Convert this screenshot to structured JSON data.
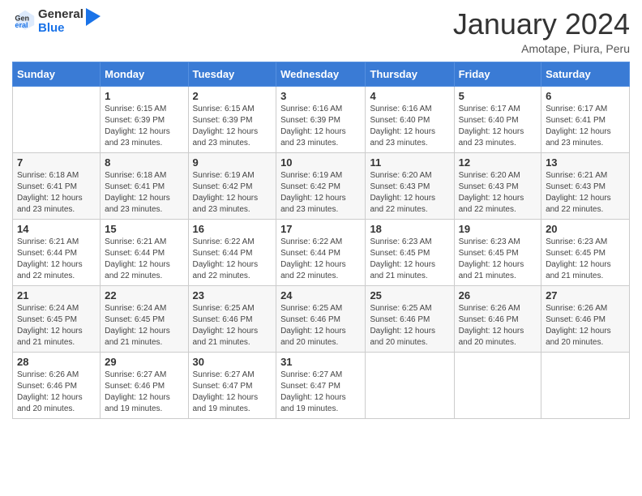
{
  "logo": {
    "general": "General",
    "blue": "Blue"
  },
  "header": {
    "month_year": "January 2024",
    "location": "Amotape, Piura, Peru"
  },
  "weekdays": [
    "Sunday",
    "Monday",
    "Tuesday",
    "Wednesday",
    "Thursday",
    "Friday",
    "Saturday"
  ],
  "weeks": [
    [
      {
        "day": "",
        "sunrise": "",
        "sunset": "",
        "daylight": ""
      },
      {
        "day": "1",
        "sunrise": "Sunrise: 6:15 AM",
        "sunset": "Sunset: 6:39 PM",
        "daylight": "Daylight: 12 hours and 23 minutes."
      },
      {
        "day": "2",
        "sunrise": "Sunrise: 6:15 AM",
        "sunset": "Sunset: 6:39 PM",
        "daylight": "Daylight: 12 hours and 23 minutes."
      },
      {
        "day": "3",
        "sunrise": "Sunrise: 6:16 AM",
        "sunset": "Sunset: 6:39 PM",
        "daylight": "Daylight: 12 hours and 23 minutes."
      },
      {
        "day": "4",
        "sunrise": "Sunrise: 6:16 AM",
        "sunset": "Sunset: 6:40 PM",
        "daylight": "Daylight: 12 hours and 23 minutes."
      },
      {
        "day": "5",
        "sunrise": "Sunrise: 6:17 AM",
        "sunset": "Sunset: 6:40 PM",
        "daylight": "Daylight: 12 hours and 23 minutes."
      },
      {
        "day": "6",
        "sunrise": "Sunrise: 6:17 AM",
        "sunset": "Sunset: 6:41 PM",
        "daylight": "Daylight: 12 hours and 23 minutes."
      }
    ],
    [
      {
        "day": "7",
        "sunrise": "Sunrise: 6:18 AM",
        "sunset": "Sunset: 6:41 PM",
        "daylight": "Daylight: 12 hours and 23 minutes."
      },
      {
        "day": "8",
        "sunrise": "Sunrise: 6:18 AM",
        "sunset": "Sunset: 6:41 PM",
        "daylight": "Daylight: 12 hours and 23 minutes."
      },
      {
        "day": "9",
        "sunrise": "Sunrise: 6:19 AM",
        "sunset": "Sunset: 6:42 PM",
        "daylight": "Daylight: 12 hours and 23 minutes."
      },
      {
        "day": "10",
        "sunrise": "Sunrise: 6:19 AM",
        "sunset": "Sunset: 6:42 PM",
        "daylight": "Daylight: 12 hours and 23 minutes."
      },
      {
        "day": "11",
        "sunrise": "Sunrise: 6:20 AM",
        "sunset": "Sunset: 6:43 PM",
        "daylight": "Daylight: 12 hours and 22 minutes."
      },
      {
        "day": "12",
        "sunrise": "Sunrise: 6:20 AM",
        "sunset": "Sunset: 6:43 PM",
        "daylight": "Daylight: 12 hours and 22 minutes."
      },
      {
        "day": "13",
        "sunrise": "Sunrise: 6:21 AM",
        "sunset": "Sunset: 6:43 PM",
        "daylight": "Daylight: 12 hours and 22 minutes."
      }
    ],
    [
      {
        "day": "14",
        "sunrise": "Sunrise: 6:21 AM",
        "sunset": "Sunset: 6:44 PM",
        "daylight": "Daylight: 12 hours and 22 minutes."
      },
      {
        "day": "15",
        "sunrise": "Sunrise: 6:21 AM",
        "sunset": "Sunset: 6:44 PM",
        "daylight": "Daylight: 12 hours and 22 minutes."
      },
      {
        "day": "16",
        "sunrise": "Sunrise: 6:22 AM",
        "sunset": "Sunset: 6:44 PM",
        "daylight": "Daylight: 12 hours and 22 minutes."
      },
      {
        "day": "17",
        "sunrise": "Sunrise: 6:22 AM",
        "sunset": "Sunset: 6:44 PM",
        "daylight": "Daylight: 12 hours and 22 minutes."
      },
      {
        "day": "18",
        "sunrise": "Sunrise: 6:23 AM",
        "sunset": "Sunset: 6:45 PM",
        "daylight": "Daylight: 12 hours and 21 minutes."
      },
      {
        "day": "19",
        "sunrise": "Sunrise: 6:23 AM",
        "sunset": "Sunset: 6:45 PM",
        "daylight": "Daylight: 12 hours and 21 minutes."
      },
      {
        "day": "20",
        "sunrise": "Sunrise: 6:23 AM",
        "sunset": "Sunset: 6:45 PM",
        "daylight": "Daylight: 12 hours and 21 minutes."
      }
    ],
    [
      {
        "day": "21",
        "sunrise": "Sunrise: 6:24 AM",
        "sunset": "Sunset: 6:45 PM",
        "daylight": "Daylight: 12 hours and 21 minutes."
      },
      {
        "day": "22",
        "sunrise": "Sunrise: 6:24 AM",
        "sunset": "Sunset: 6:45 PM",
        "daylight": "Daylight: 12 hours and 21 minutes."
      },
      {
        "day": "23",
        "sunrise": "Sunrise: 6:25 AM",
        "sunset": "Sunset: 6:46 PM",
        "daylight": "Daylight: 12 hours and 21 minutes."
      },
      {
        "day": "24",
        "sunrise": "Sunrise: 6:25 AM",
        "sunset": "Sunset: 6:46 PM",
        "daylight": "Daylight: 12 hours and 20 minutes."
      },
      {
        "day": "25",
        "sunrise": "Sunrise: 6:25 AM",
        "sunset": "Sunset: 6:46 PM",
        "daylight": "Daylight: 12 hours and 20 minutes."
      },
      {
        "day": "26",
        "sunrise": "Sunrise: 6:26 AM",
        "sunset": "Sunset: 6:46 PM",
        "daylight": "Daylight: 12 hours and 20 minutes."
      },
      {
        "day": "27",
        "sunrise": "Sunrise: 6:26 AM",
        "sunset": "Sunset: 6:46 PM",
        "daylight": "Daylight: 12 hours and 20 minutes."
      }
    ],
    [
      {
        "day": "28",
        "sunrise": "Sunrise: 6:26 AM",
        "sunset": "Sunset: 6:46 PM",
        "daylight": "Daylight: 12 hours and 20 minutes."
      },
      {
        "day": "29",
        "sunrise": "Sunrise: 6:27 AM",
        "sunset": "Sunset: 6:46 PM",
        "daylight": "Daylight: 12 hours and 19 minutes."
      },
      {
        "day": "30",
        "sunrise": "Sunrise: 6:27 AM",
        "sunset": "Sunset: 6:47 PM",
        "daylight": "Daylight: 12 hours and 19 minutes."
      },
      {
        "day": "31",
        "sunrise": "Sunrise: 6:27 AM",
        "sunset": "Sunset: 6:47 PM",
        "daylight": "Daylight: 12 hours and 19 minutes."
      },
      {
        "day": "",
        "sunrise": "",
        "sunset": "",
        "daylight": ""
      },
      {
        "day": "",
        "sunrise": "",
        "sunset": "",
        "daylight": ""
      },
      {
        "day": "",
        "sunrise": "",
        "sunset": "",
        "daylight": ""
      }
    ]
  ]
}
